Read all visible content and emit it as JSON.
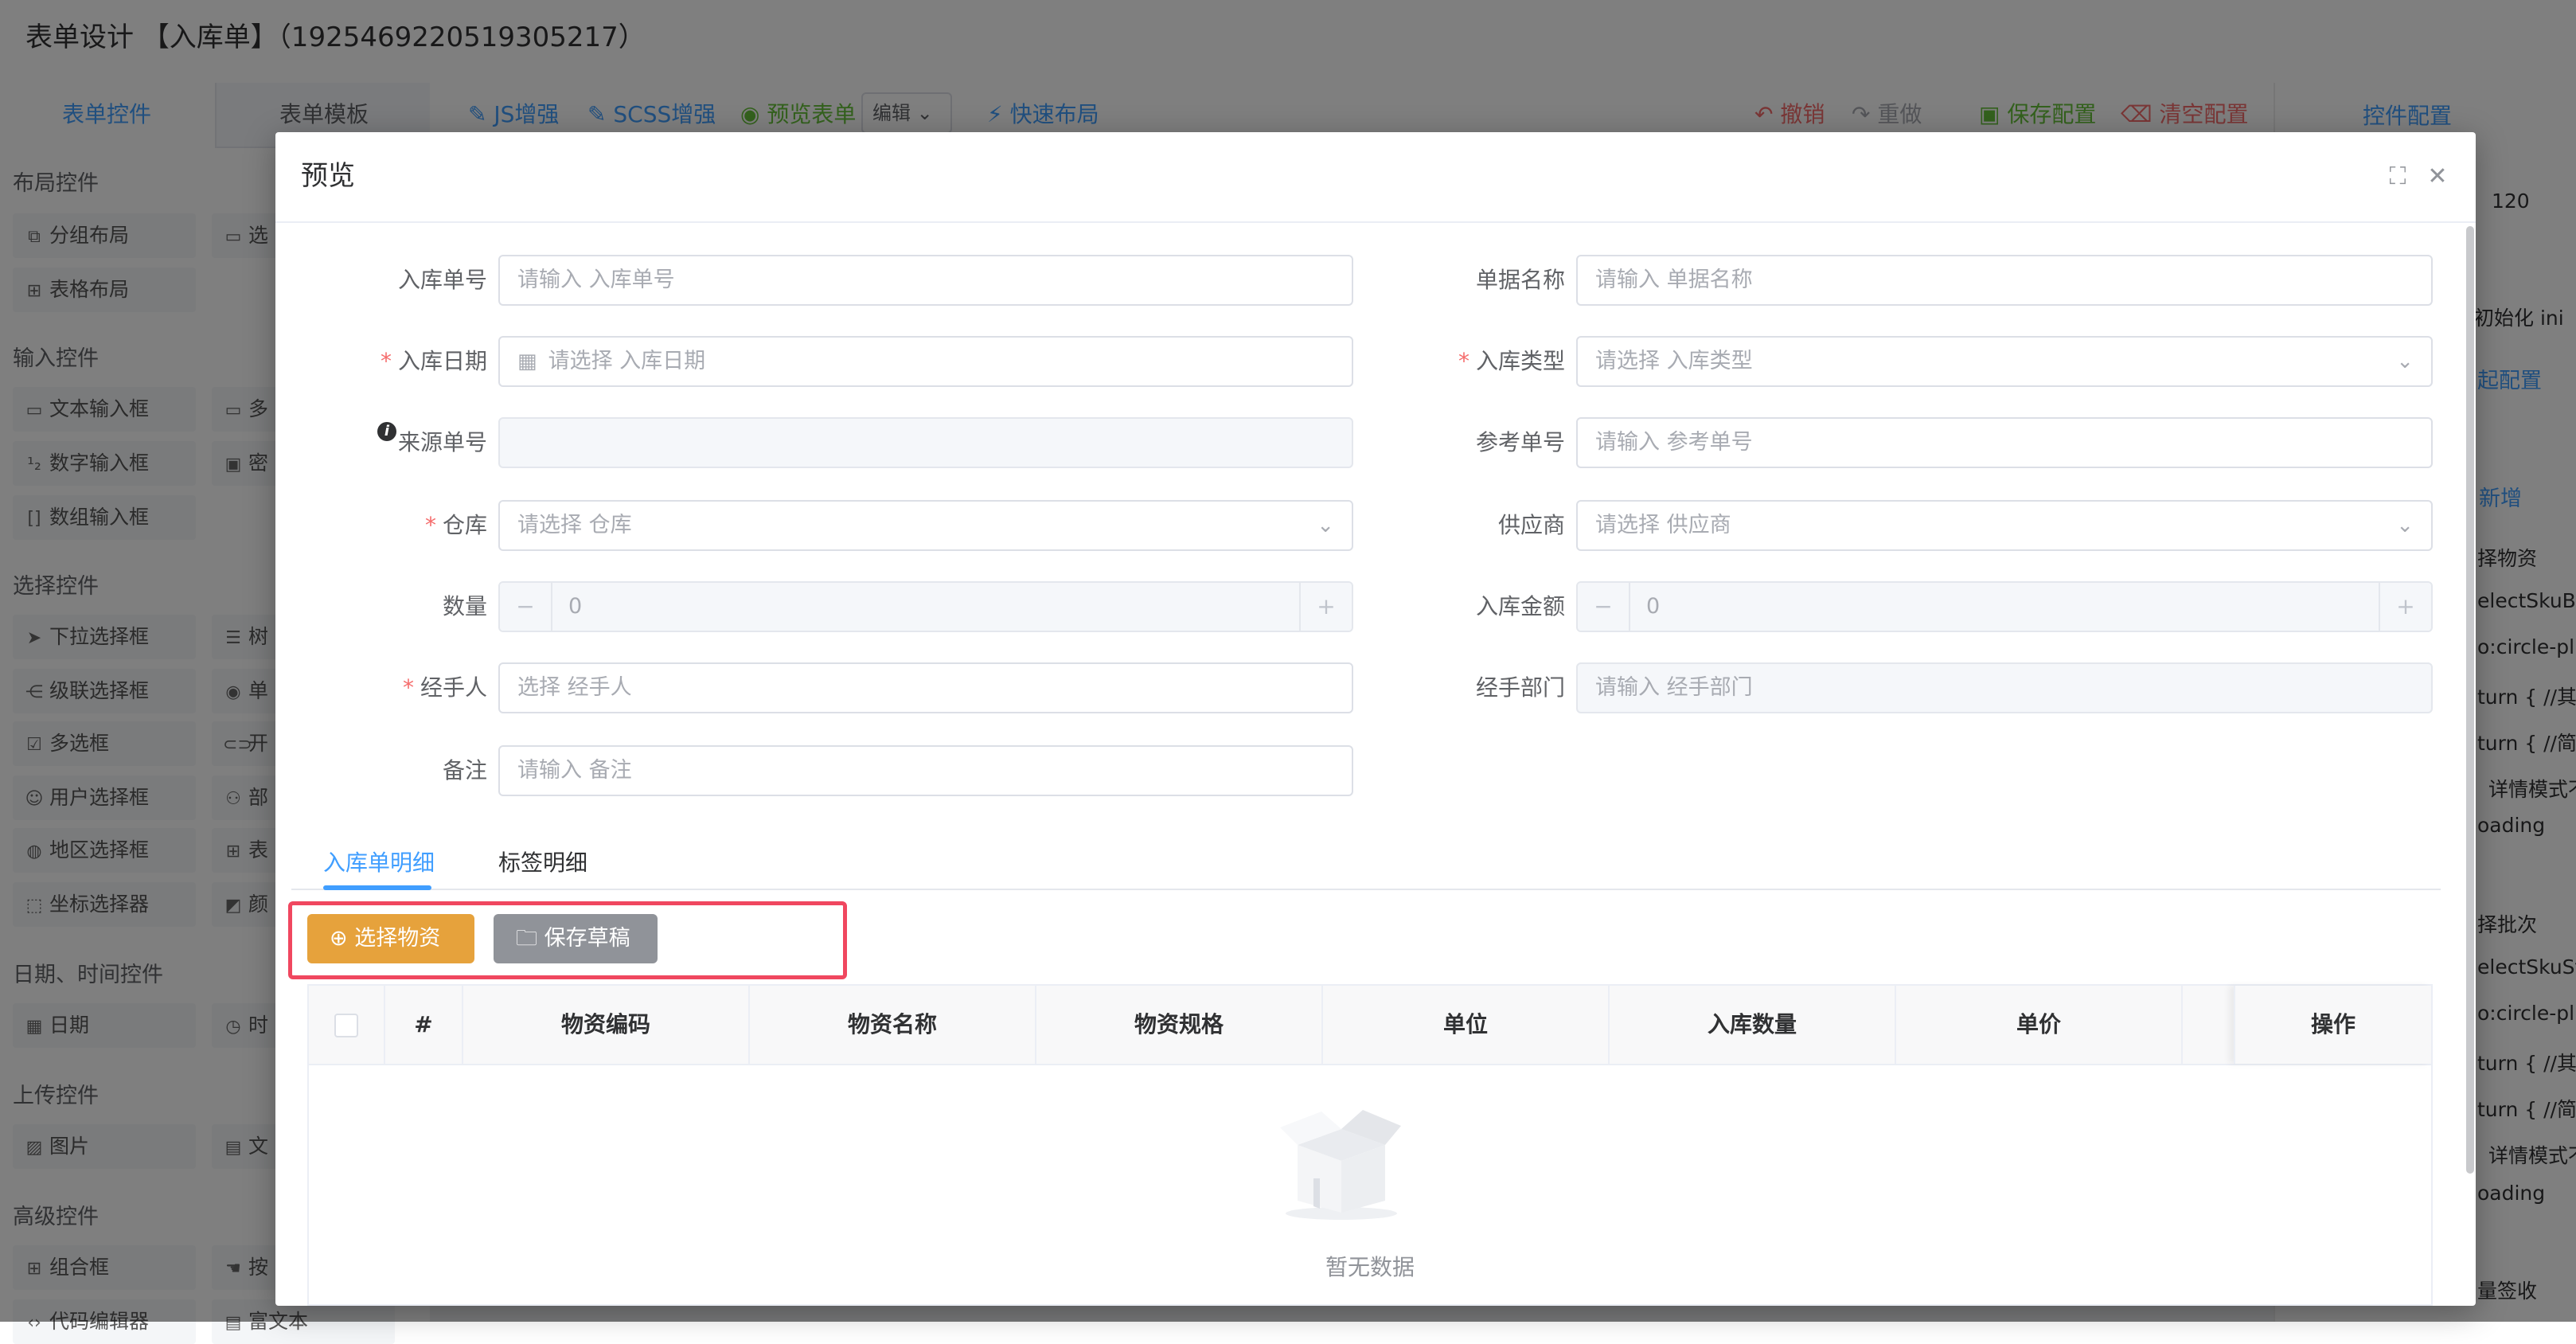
{
  "app": {
    "title": "表单设计 【入库单】（1925469220519305217）"
  },
  "left_panel": {
    "tabs": [
      "表单控件",
      "表单模板"
    ],
    "groups": [
      {
        "title": "布局控件",
        "items": [
          [
            "分组布局",
            "选"
          ],
          [
            "表格布局",
            ""
          ]
        ]
      },
      {
        "title": "输入控件",
        "items": [
          [
            "文本输入框",
            "多"
          ],
          [
            "数字输入框",
            "密"
          ],
          [
            "数组输入框",
            ""
          ]
        ]
      },
      {
        "title": "选择控件",
        "items": [
          [
            "下拉选择框",
            "树"
          ],
          [
            "级联选择框",
            "单"
          ],
          [
            "多选框",
            "开"
          ],
          [
            "用户选择框",
            "部"
          ],
          [
            "地区选择框",
            "表"
          ],
          [
            "坐标选择器",
            "颜"
          ]
        ]
      },
      {
        "title": "日期、时间控件",
        "items": [
          [
            "日期",
            "时"
          ]
        ]
      },
      {
        "title": "上传控件",
        "items": [
          [
            "图片",
            "文"
          ]
        ]
      },
      {
        "title": "高级控件",
        "items": [
          [
            "组合框",
            "按"
          ],
          [
            "代码编辑器",
            "富文本"
          ]
        ]
      }
    ]
  },
  "toolbar": {
    "js": "JS增强",
    "scss": "SCSS增强",
    "preview": "预览表单",
    "mode": "编辑",
    "quick_layout": "快速布局",
    "undo": "撤销",
    "redo": "重做",
    "save": "保存配置",
    "clear": "清空配置"
  },
  "right_panel": {
    "title": "控件配置",
    "lines": [
      "120",
      "初始化  ini",
      "起配置",
      "新增",
      "择物资",
      "electSkuBtn",
      "o:circle-plu",
      "turn {  //其他",
      "turn {  //简化",
      "详情模式不",
      "oading",
      "择批次",
      "electSkuSto",
      "o:circle-plu",
      "turn {  //其他",
      "turn {  //简化",
      "详情模式不",
      "oading",
      "量签收"
    ]
  },
  "dialog": {
    "title": "预览",
    "fields_left": [
      {
        "label": "入库单号",
        "required": false,
        "placeholder": "请输入 入库单号",
        "kind": "text"
      },
      {
        "label": "入库日期",
        "required": true,
        "placeholder": "请选择 入库日期",
        "kind": "date"
      },
      {
        "label": "来源单号",
        "required": false,
        "placeholder": "",
        "kind": "disabled",
        "info": "i"
      },
      {
        "label": "仓库",
        "required": true,
        "placeholder": "请选择 仓库",
        "kind": "select"
      },
      {
        "label": "数量",
        "required": false,
        "placeholder": "0",
        "kind": "number"
      },
      {
        "label": "经手人",
        "required": true,
        "placeholder": "选择 经手人",
        "kind": "text"
      },
      {
        "label": "备注",
        "required": false,
        "placeholder": "请输入 备注",
        "kind": "text"
      }
    ],
    "fields_right": [
      {
        "label": "单据名称",
        "required": false,
        "placeholder": "请输入 单据名称",
        "kind": "text"
      },
      {
        "label": "入库类型",
        "required": true,
        "placeholder": "请选择 入库类型",
        "kind": "select"
      },
      {
        "label": "参考单号",
        "required": false,
        "placeholder": "请输入 参考单号",
        "kind": "text"
      },
      {
        "label": "供应商",
        "required": false,
        "placeholder": "请选择 供应商",
        "kind": "select"
      },
      {
        "label": "入库金额",
        "required": false,
        "placeholder": "0",
        "kind": "number"
      },
      {
        "label": "经手部门",
        "required": false,
        "placeholder": "请输入 经手部门",
        "kind": "disabled"
      }
    ],
    "tabs": [
      "入库单明细",
      "标签明细"
    ],
    "buttons": {
      "select_material": "选择物资",
      "save_draft": "保存草稿"
    },
    "table": {
      "columns": [
        "",
        "#",
        "物资编码",
        "物资名称",
        "物资规格",
        "单位",
        "入库数量",
        "单价",
        "操作"
      ],
      "empty_text": "暂无数据"
    }
  },
  "colors": {
    "primary": "#409eff",
    "warning": "#e6a23c",
    "info": "#909399",
    "danger": "#f56c6c",
    "success": "#67c23a",
    "highlight": "#f0475f"
  }
}
